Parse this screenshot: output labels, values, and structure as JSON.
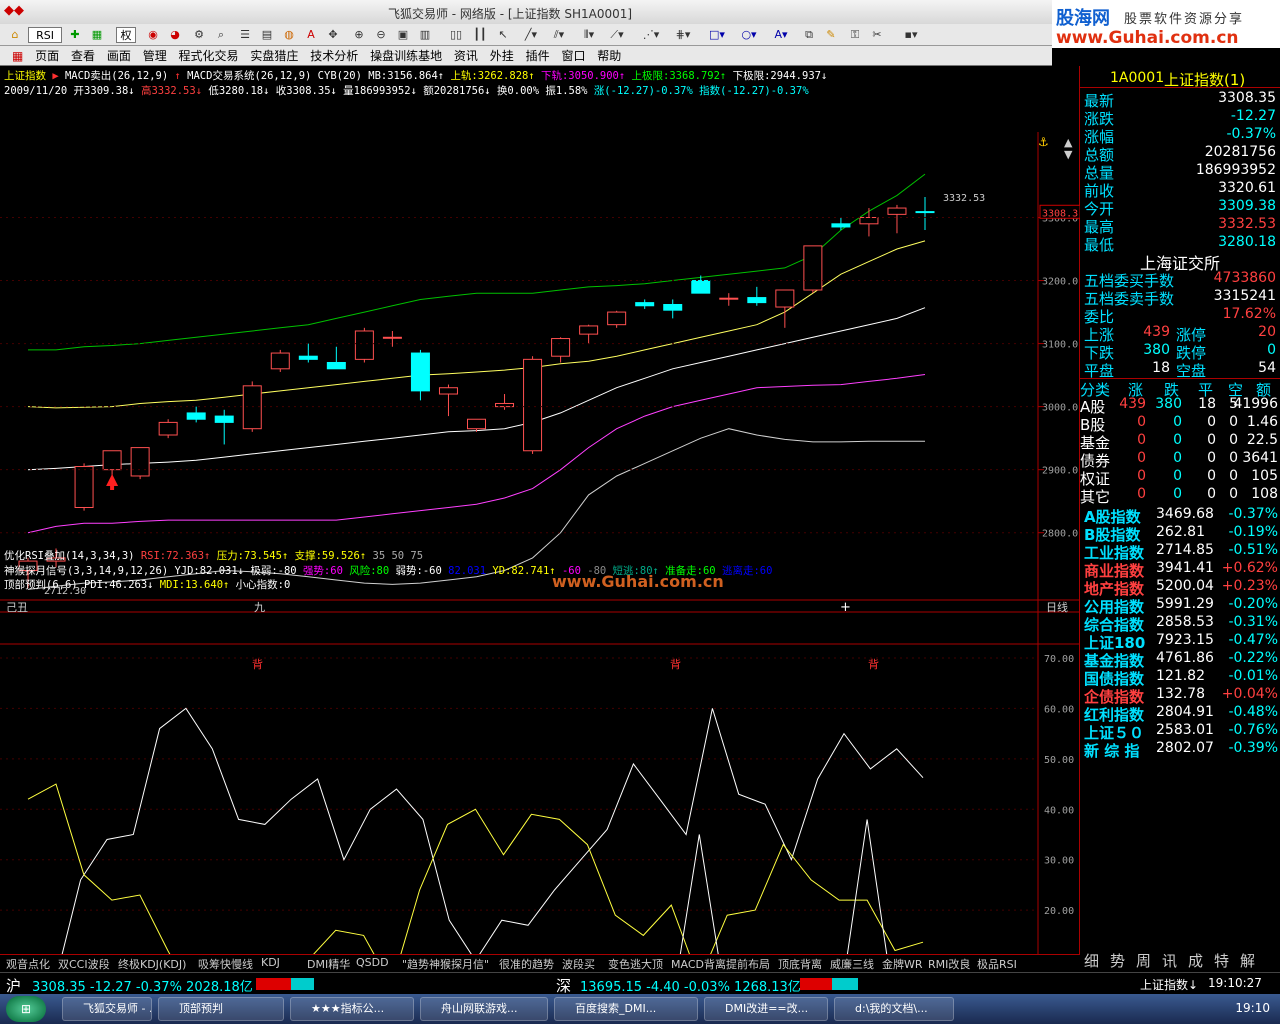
{
  "window": {
    "title": "飞狐交易师 - 网络版 - [上证指数 SH1A0001]"
  },
  "brand": {
    "name": "股海网",
    "slogan": "股票软件资源分享",
    "url": "www.Guhai.com.cn"
  },
  "menu": [
    "页面",
    "查看",
    "画面",
    "管理",
    "程式化交易",
    "实盘猎庄",
    "技术分析",
    "操盘训练基地",
    "资讯",
    "外挂",
    "插件",
    "窗口",
    "帮助"
  ],
  "toolbar": {
    "quan": "权"
  },
  "main": {
    "line1": [
      {
        "t": "上证指数",
        "c": "#ffff00"
      },
      {
        "t": "▶",
        "c": "#ff3030"
      },
      {
        "t": "MACD卖出(26,12,9)",
        "c": "#ffffff"
      },
      {
        "t": "↑",
        "c": "#ff3030"
      },
      {
        "t": "MACD交易系统(26,12,9)",
        "c": "#ffffff"
      },
      {
        "t": "CYB(20)",
        "c": "#ffffff"
      },
      {
        "t": "MB:3156.864↑",
        "c": "#ffffff"
      },
      {
        "t": "上轨:3262.828↑",
        "c": "#ffff00"
      },
      {
        "t": "下轨:3050.900↑",
        "c": "#ff00ff"
      },
      {
        "t": "上极限:3368.792↑",
        "c": "#00ff00"
      },
      {
        "t": "下极限:2944.937↓",
        "c": "#ffffff"
      }
    ],
    "line2": [
      {
        "t": "2009/11/20",
        "c": "#ffffff"
      },
      {
        "t": "开3309.38↓",
        "c": "#ffffff"
      },
      {
        "t": "高3332.53↓",
        "c": "#ff4040"
      },
      {
        "t": "低3280.18↓",
        "c": "#ffffff"
      },
      {
        "t": "收3308.35↓",
        "c": "#ffffff"
      },
      {
        "t": "量186993952↓",
        "c": "#ffffff"
      },
      {
        "t": "额20281756↓",
        "c": "#ffffff"
      },
      {
        "t": "换0.00%",
        "c": "#ffffff"
      },
      {
        "t": "振1.58%",
        "c": "#ffffff"
      },
      {
        "t": "涨(-12.27)-0.37%",
        "c": "#00ffff"
      },
      {
        "t": "指数(-12.27)-0.37%",
        "c": "#00ffff"
      }
    ],
    "price_axis": [
      "3300.0",
      "3200.0",
      "3100.0",
      "3000.0",
      "2900.0",
      "2800.0"
    ],
    "cur_price": "3308.3",
    "high_label": "3332.53",
    "low_label": "2712.30",
    "date_labels": [
      "己丑",
      "九"
    ],
    "period": "日线",
    "watermark": "www.Guhai.com.cn",
    "ind_line1": [
      {
        "t": "优化RSI叠加(14,3,34,3)",
        "c": "#ffffff"
      },
      {
        "t": "RSI:72.363↑",
        "c": "#ff4040"
      },
      {
        "t": "压力:73.545↑",
        "c": "#ffff00"
      },
      {
        "t": "支撑:59.526↑",
        "c": "#ffff00"
      },
      {
        "t": "35  50  75",
        "c": "#aaaaaa"
      }
    ],
    "ind_line2": [
      {
        "t": "神猴探月信号(3,3,14,9,12,26)",
        "c": "#ffffff"
      },
      {
        "t": "YJD:82.031↓",
        "c": "#ffffff"
      },
      {
        "t": "极弱:-80",
        "c": "#ffffff"
      },
      {
        "t": "强势:60",
        "c": "#ff00ff"
      },
      {
        "t": "风险:80",
        "c": "#00ff00"
      },
      {
        "t": "弱势:-60",
        "c": "#ffffff"
      },
      {
        "t": "82.031",
        "c": "#0000ff"
      },
      {
        "t": "YD:82.741↑",
        "c": "#ffff00"
      },
      {
        "t": "-60",
        "c": "#ff00ff"
      },
      {
        "t": "-80",
        "c": "#888888"
      },
      {
        "t": "短逃:80↑",
        "c": "#00aa88"
      },
      {
        "t": "准备走:60",
        "c": "#00ff00"
      },
      {
        "t": "逃离走:60",
        "c": "#0000ff"
      }
    ],
    "ind_line3": [
      {
        "t": "顶部预判(6,6)",
        "c": "#ffffff"
      },
      {
        "t": "PDI:46.263↓",
        "c": "#ffffff"
      },
      {
        "t": "MDI:13.640↑",
        "c": "#ffff00"
      },
      {
        "t": "小心指数:0",
        "c": "#ffffff"
      }
    ],
    "osc_axis": [
      "70.00",
      "60.00",
      "50.00",
      "40.00",
      "30.00",
      "20.00",
      "10.00",
      "0.00"
    ],
    "bei_label": "背"
  },
  "quote": {
    "code": "1A0001",
    "name": "上证指数(1)",
    "rows": [
      {
        "k": "最新",
        "v": "3308.35",
        "c": "#ffffff"
      },
      {
        "k": "涨跌",
        "v": "-12.27",
        "c": "#00ffff"
      },
      {
        "k": "涨幅",
        "v": "-0.37%",
        "c": "#00ffff"
      },
      {
        "k": "总额",
        "v": "20281756",
        "c": "#ffffff"
      },
      {
        "k": "总量",
        "v": "186993952",
        "c": "#ffffff"
      },
      {
        "k": "前收",
        "v": "3320.61",
        "c": "#ffffff"
      },
      {
        "k": "今开",
        "v": "3309.38",
        "c": "#00ffff"
      },
      {
        "k": "最高",
        "v": "3332.53",
        "c": "#ff4040"
      },
      {
        "k": "最低",
        "v": "3280.18",
        "c": "#00ffff"
      }
    ],
    "exchange": "上海证交所",
    "rows2": [
      {
        "k": "五档委买手数",
        "v": "4733860",
        "c": "#ff4040"
      },
      {
        "k": "五档委卖手数",
        "v": "3315241",
        "c": "#ffffff"
      },
      {
        "k": "委比",
        "v": "17.62%",
        "c": "#ff4040"
      }
    ],
    "updown": [
      {
        "k": "上涨",
        "v": "439",
        "k2": "涨停",
        "v2": "20"
      },
      {
        "k": "下跌",
        "v": "380",
        "k2": "跌停",
        "v2": "0"
      },
      {
        "k": "平盘",
        "v": "18",
        "k2": "空盘",
        "v2": "54"
      }
    ],
    "cat_header": [
      "分类",
      "涨",
      "跌",
      "平",
      "空",
      "额"
    ],
    "cats": [
      [
        "A股",
        "439",
        "380",
        "18",
        "5",
        "41996"
      ],
      [
        "B股",
        "0",
        "0",
        "0",
        "0",
        "1.46"
      ],
      [
        "基金",
        "0",
        "0",
        "0",
        "0",
        "22.5"
      ],
      [
        "债券",
        "0",
        "0",
        "0",
        "0",
        "3641"
      ],
      [
        "权证",
        "0",
        "0",
        "0",
        "0",
        "105"
      ],
      [
        "其它",
        "0",
        "0",
        "0",
        "0",
        "108"
      ]
    ],
    "indices": [
      {
        "k": "A股指数",
        "v": "3469.68",
        "p": "-0.37%",
        "c": "#00ffff"
      },
      {
        "k": "B股指数",
        "v": "262.81",
        "p": "-0.19%",
        "c": "#00ffff"
      },
      {
        "k": "工业指数",
        "v": "2714.85",
        "p": "-0.51%",
        "c": "#00ffff"
      },
      {
        "k": "商业指数",
        "v": "3941.41",
        "p": "+0.62%",
        "c": "#ff4040"
      },
      {
        "k": "地产指数",
        "v": "5200.04",
        "p": "+0.23%",
        "c": "#ff4040"
      },
      {
        "k": "公用指数",
        "v": "5991.29",
        "p": "-0.20%",
        "c": "#00ffff"
      },
      {
        "k": "综合指数",
        "v": "2858.53",
        "p": "-0.31%",
        "c": "#00ffff"
      },
      {
        "k": "上证180",
        "v": "7923.15",
        "p": "-0.47%",
        "c": "#00ffff"
      },
      {
        "k": "基金指数",
        "v": "4761.86",
        "p": "-0.22%",
        "c": "#00ffff"
      },
      {
        "k": "国债指数",
        "v": "121.82",
        "p": "-0.01%",
        "c": "#00ffff"
      },
      {
        "k": "企债指数",
        "v": "132.78",
        "p": "+0.04%",
        "c": "#ff4040"
      },
      {
        "k": "红利指数",
        "v": "2804.91",
        "p": "-0.48%",
        "c": "#00ffff"
      },
      {
        "k": "上证５０",
        "v": "2583.01",
        "p": "-0.76%",
        "c": "#00ffff"
      },
      {
        "k": "新 综 指",
        "v": "2802.07",
        "p": "-0.39%",
        "c": "#00ffff"
      }
    ],
    "side_tabs": [
      "细",
      "势",
      "周",
      "讯",
      "成",
      "特",
      "解"
    ]
  },
  "tabs": [
    "观音点化",
    "双CCI波段",
    "终极KDJ(KDJ)",
    "吸筹快慢线",
    "KDJ",
    "DMI精华",
    "QSDD",
    "\"趋势神猴探月信\"",
    "很准的趋势",
    "波段买",
    "变色逃大顶",
    "MACD背离",
    "提前布局",
    "顶底背离",
    "威廉三线",
    "金牌WR",
    "RMI改良",
    "极品RSI"
  ],
  "status": {
    "sh_label": "沪",
    "sh_value": "3308.35 -12.27 -0.37% 2028.18亿",
    "sz_label": "深",
    "sz_value": "13695.15 -4.40 -0.03% 1268.13亿",
    "right_label": "上证指数↓"
  },
  "taskbar": {
    "items": [
      "飞狐交易师 - ...",
      "顶部预判",
      "★★★指标公...",
      "舟山网联游戏...",
      "百度搜索_DMI...",
      "DMI改进==改...",
      "d:\\我的文档\\..."
    ],
    "time": "19:10"
  },
  "chart_data": [
    {
      "type": "candlestick",
      "title": "上证指数",
      "ylim": [
        2712.3,
        3332.53
      ],
      "candles": [
        {
          "o": 2740,
          "h": 2760,
          "l": 2712.3,
          "c": 2755
        },
        {
          "o": 2755,
          "h": 2775,
          "l": 2745,
          "c": 2760
        },
        {
          "o": 2840,
          "h": 2910,
          "l": 2835,
          "c": 2905
        },
        {
          "o": 2900,
          "h": 2925,
          "l": 2880,
          "c": 2930
        },
        {
          "o": 2890,
          "h": 2935,
          "l": 2885,
          "c": 2935
        },
        {
          "o": 2955,
          "h": 2980,
          "l": 2950,
          "c": 2975
        },
        {
          "o": 2990,
          "h": 3000,
          "l": 2975,
          "c": 2980
        },
        {
          "o": 2985,
          "h": 2995,
          "l": 2940,
          "c": 2975
        },
        {
          "o": 2965,
          "h": 3040,
          "l": 2960,
          "c": 3033
        },
        {
          "o": 3060,
          "h": 3090,
          "l": 3055,
          "c": 3085
        },
        {
          "o": 3080,
          "h": 3100,
          "l": 3070,
          "c": 3075
        },
        {
          "o": 3070,
          "h": 3095,
          "l": 3060,
          "c": 3060
        },
        {
          "o": 3075,
          "h": 3125,
          "l": 3070,
          "c": 3120
        },
        {
          "o": 3110,
          "h": 3120,
          "l": 3095,
          "c": 3110
        },
        {
          "o": 3085,
          "h": 3090,
          "l": 3010,
          "c": 3025
        },
        {
          "o": 3020,
          "h": 3035,
          "l": 2985,
          "c": 3030
        },
        {
          "o": 2965,
          "h": 2980,
          "l": 2960,
          "c": 2980
        },
        {
          "o": 3000,
          "h": 3020,
          "l": 2995,
          "c": 3005
        },
        {
          "o": 2930,
          "h": 3080,
          "l": 2925,
          "c": 3075
        },
        {
          "o": 3080,
          "h": 3110,
          "l": 3070,
          "c": 3108
        },
        {
          "o": 3115,
          "h": 3130,
          "l": 3100,
          "c": 3128
        },
        {
          "o": 3130,
          "h": 3152,
          "l": 3125,
          "c": 3150
        },
        {
          "o": 3165,
          "h": 3170,
          "l": 3155,
          "c": 3160
        },
        {
          "o": 3162,
          "h": 3170,
          "l": 3140,
          "c": 3153
        },
        {
          "o": 3200,
          "h": 3208,
          "l": 3180,
          "c": 3180
        },
        {
          "o": 3172,
          "h": 3180,
          "l": 3160,
          "c": 3172
        },
        {
          "o": 3173,
          "h": 3190,
          "l": 3160,
          "c": 3165
        },
        {
          "o": 3158,
          "h": 3185,
          "l": 3125,
          "c": 3185
        },
        {
          "o": 3185,
          "h": 3255,
          "l": 3180,
          "c": 3255
        },
        {
          "o": 3290,
          "h": 3300,
          "l": 3280,
          "c": 3285
        },
        {
          "o": 3290,
          "h": 3315,
          "l": 3270,
          "c": 3300
        },
        {
          "o": 3305,
          "h": 3320,
          "l": 3275,
          "c": 3315
        },
        {
          "o": 3309.38,
          "h": 3332.53,
          "l": 3280.18,
          "c": 3308.35
        }
      ],
      "bands": [
        {
          "name": "上极限",
          "color": "#00c000",
          "values": [
            3090,
            3090,
            3095,
            3097,
            3100,
            3105,
            3110,
            3115,
            3120,
            3125,
            3130,
            3140,
            3150,
            3160,
            3170,
            3175,
            3180,
            3180,
            3180,
            3185,
            3190,
            3192,
            3195,
            3200,
            3205,
            3210,
            3215,
            3220,
            3240,
            3280,
            3310,
            3335,
            3368.79
          ]
        },
        {
          "name": "上轨",
          "color": "#ffff60",
          "values": [
            3000,
            2998,
            2999,
            3000,
            3005,
            3008,
            3010,
            3015,
            3020,
            3025,
            3030,
            3035,
            3040,
            3045,
            3050,
            3052,
            3055,
            3058,
            3062,
            3068,
            3072,
            3080,
            3090,
            3100,
            3110,
            3120,
            3130,
            3150,
            3180,
            3210,
            3230,
            3250,
            3262.83
          ]
        },
        {
          "name": "MB",
          "color": "#ffffff",
          "values": [
            2900,
            2902,
            2905,
            2908,
            2910,
            2912,
            2915,
            2920,
            2925,
            2930,
            2935,
            2940,
            2945,
            2950,
            2955,
            2960,
            2962,
            2965,
            2975,
            2990,
            3010,
            3030,
            3045,
            3060,
            3070,
            3080,
            3090,
            3100,
            3110,
            3120,
            3130,
            3140,
            3156.86
          ]
        },
        {
          "name": "下轨",
          "color": "#ff40ff",
          "values": [
            2800,
            2810,
            2815,
            2815,
            2818,
            2820,
            2820,
            2820,
            2820,
            2820,
            2820,
            2820,
            2825,
            2830,
            2835,
            2840,
            2845,
            2855,
            2870,
            2900,
            2935,
            2965,
            2985,
            3000,
            3010,
            3020,
            3030,
            3032,
            3034,
            3035,
            3040,
            3045,
            3050.9
          ]
        },
        {
          "name": "下极限",
          "color": "#d0d0d0",
          "values": [
            2710,
            2715,
            2720,
            2722,
            2725,
            2730,
            2735,
            2740,
            2738,
            2735,
            2730,
            2725,
            2720,
            2718,
            2720,
            2725,
            2730,
            2740,
            2760,
            2800,
            2860,
            2890,
            2910,
            2930,
            2950,
            2965,
            2955,
            2948,
            2944,
            2944,
            2945,
            2945,
            2944.94
          ]
        }
      ]
    },
    {
      "type": "line",
      "title": "顶部预判(6,6)",
      "ylim": [
        0,
        70
      ],
      "series": [
        {
          "name": "PDI",
          "color": "#ffffff",
          "values": [
            2,
            5,
            26,
            34,
            35,
            56,
            60,
            52,
            38,
            37,
            42,
            46,
            30,
            40,
            44,
            38,
            18,
            10,
            18,
            17,
            24,
            30,
            36,
            49,
            42,
            35,
            60,
            43,
            41,
            30,
            46,
            55,
            48,
            52,
            46.26
          ]
        },
        {
          "name": "MDI",
          "color": "#ffff40",
          "values": [
            42,
            45,
            27,
            22,
            23,
            12,
            2,
            9,
            11,
            11,
            10,
            16,
            15,
            5,
            24,
            37,
            40,
            31,
            39,
            38,
            33,
            19,
            15,
            21,
            6,
            19,
            20,
            33,
            26,
            22,
            22,
            12,
            13.64
          ]
        },
        {
          "name": "小心指数",
          "color": "#ffffff",
          "values": [
            0,
            0,
            0,
            0,
            0,
            0,
            0,
            0,
            0,
            0,
            0,
            0,
            0,
            0,
            0,
            0,
            0,
            0,
            7,
            0,
            0,
            0,
            0,
            0,
            35,
            0,
            0,
            0,
            0,
            0,
            38,
            0,
            0
          ]
        }
      ]
    }
  ]
}
